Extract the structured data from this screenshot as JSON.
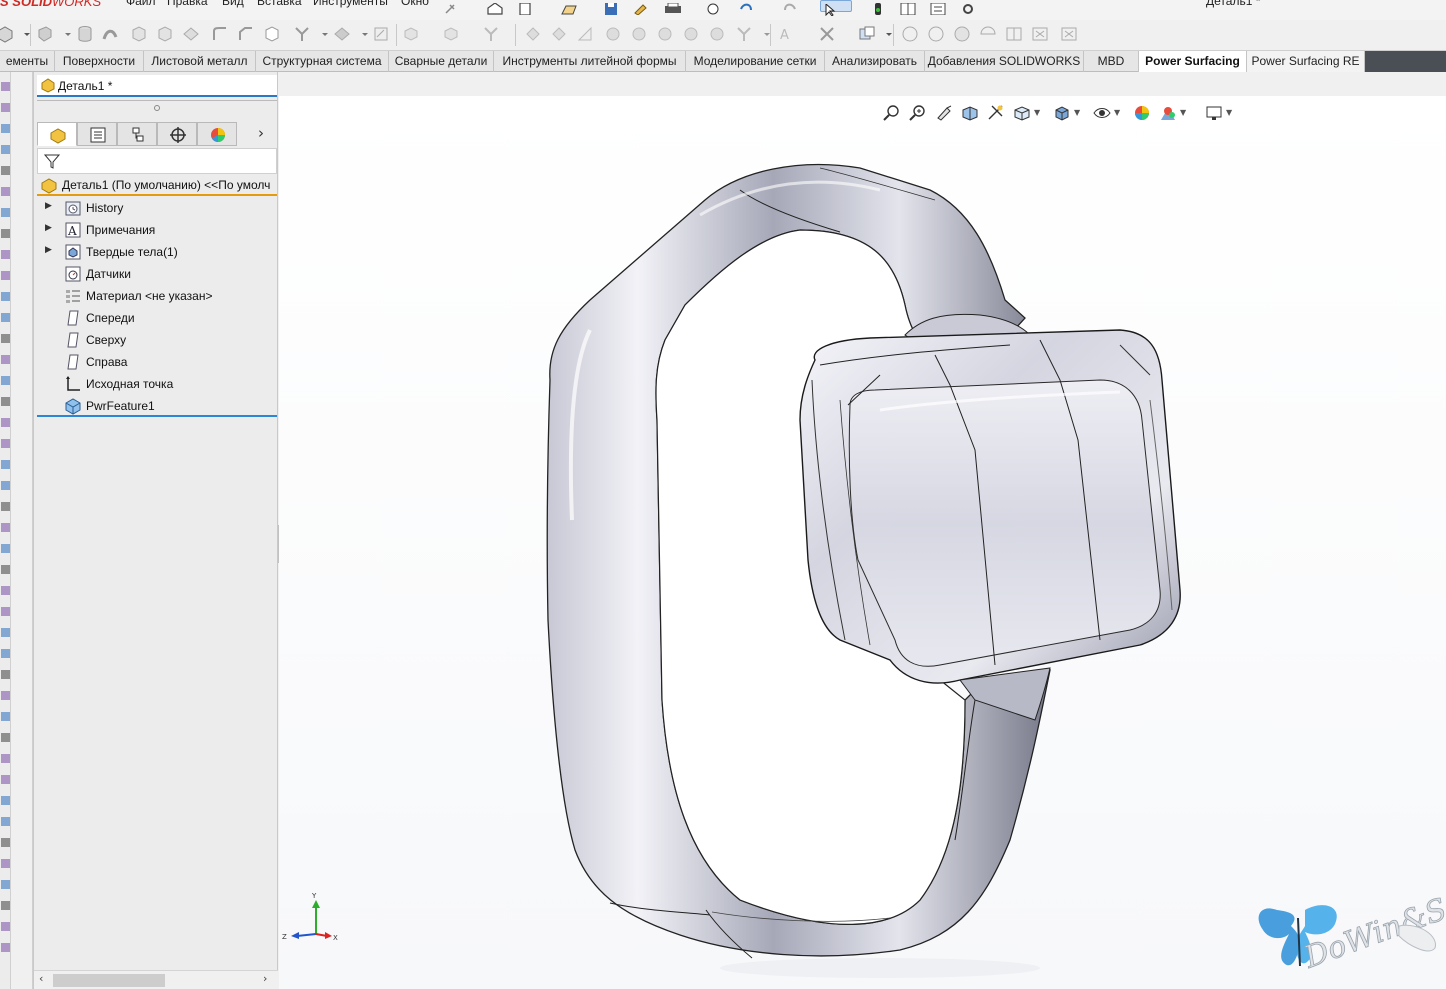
{
  "app": {
    "logo_brand": "S SOLID",
    "logo_works": "WORKS",
    "document_title": "Деталь1 *"
  },
  "menu": [
    "Файл",
    "Правка",
    "Вид",
    "Вставка",
    "Инструменты",
    "Окно"
  ],
  "command_tabs": [
    {
      "label": "ементы"
    },
    {
      "label": "Поверхности"
    },
    {
      "label": "Листовой металл"
    },
    {
      "label": "Структурная система"
    },
    {
      "label": "Сварные детали"
    },
    {
      "label": "Инструменты литейной формы"
    },
    {
      "label": "Моделирование сетки"
    },
    {
      "label": "Анализировать"
    },
    {
      "label": "Добавления SOLIDWORKS"
    },
    {
      "label": "MBD"
    },
    {
      "label": "Power Surfacing"
    },
    {
      "label": "Power Surfacing RE"
    }
  ],
  "active_command_tab": "Power Surfacing",
  "feature_manager": {
    "doc_tab": "Деталь1 *",
    "root_label": "Деталь1 (По умолчанию) <<По умолч",
    "tabs": [
      "feature-manager-icon",
      "property-manager-icon",
      "configuration-manager-icon",
      "dimxpert-icon",
      "display-manager-icon"
    ],
    "items": [
      {
        "label": "History",
        "icon": "history-folder-icon",
        "expandable": true
      },
      {
        "label": "Примечания",
        "icon": "annotations-icon",
        "expandable": true
      },
      {
        "label": "Твердые тела(1)",
        "icon": "solid-bodies-icon",
        "expandable": true
      },
      {
        "label": "Датчики",
        "icon": "sensors-icon",
        "expandable": false
      },
      {
        "label": "Материал <не указан>",
        "icon": "material-icon",
        "expandable": false
      },
      {
        "label": "Спереди",
        "icon": "plane-icon",
        "expandable": false
      },
      {
        "label": "Сверху",
        "icon": "plane-icon",
        "expandable": false
      },
      {
        "label": "Справа",
        "icon": "plane-icon",
        "expandable": false
      },
      {
        "label": "Исходная точка",
        "icon": "origin-icon",
        "expandable": false
      },
      {
        "label": "PwrFeature1",
        "icon": "pwr-feature-icon",
        "expandable": false
      }
    ]
  },
  "triad": {
    "x": "X",
    "y": "Y",
    "z": "Z"
  },
  "watermark": "DoWin&Soft",
  "colors": {
    "accent_blue": "#2b86d6",
    "root_underline": "#e49b0f",
    "model_shade": "#c9cad6",
    "brand_red": "#d02a25"
  }
}
